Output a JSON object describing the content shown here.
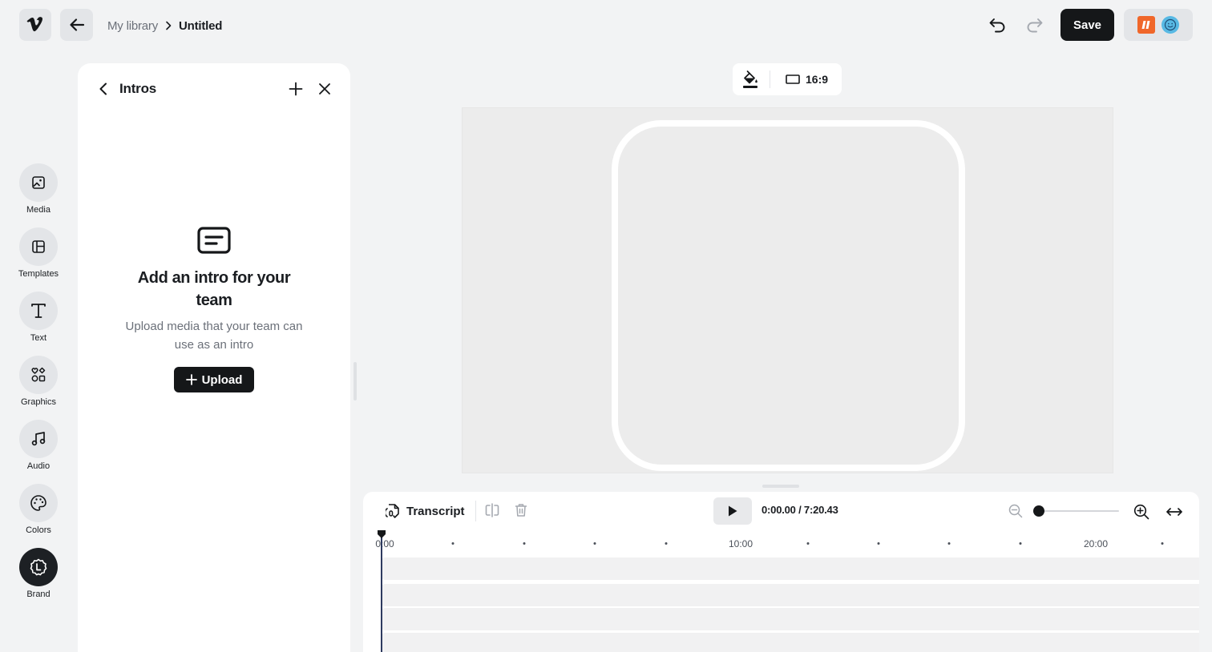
{
  "header": {
    "breadcrumb": {
      "library": "My library",
      "current": "Untitled"
    },
    "save_label": "Save"
  },
  "rail": {
    "items": [
      {
        "label": "Media",
        "icon": "image-icon"
      },
      {
        "label": "Templates",
        "icon": "layout-icon"
      },
      {
        "label": "Text",
        "icon": "text-icon"
      },
      {
        "label": "Graphics",
        "icon": "shapes-icon"
      },
      {
        "label": "Audio",
        "icon": "music-note-icon"
      },
      {
        "label": "Colors",
        "icon": "palette-icon"
      },
      {
        "label": "Brand",
        "icon": "brand-badge-icon",
        "active": true
      }
    ]
  },
  "panel": {
    "title": "Intros",
    "empty_heading": "Add an intro for your team",
    "empty_description": "Upload media that your team can use as an intro",
    "upload_label": "Upload"
  },
  "canvas": {
    "aspect_ratio": "16:9"
  },
  "timeline": {
    "transcript_label": "Transcript",
    "current_time": "0:00.00",
    "total_time": "7:20.43",
    "time_readout": "0:00.00 / 7:20.43",
    "zoom_level": 0,
    "ruler_labels": [
      "0:00",
      "10:00",
      "20:00"
    ]
  },
  "colors": {
    "background": "#f2f3f4",
    "primary_button": "#151719",
    "team_logo": "#f0672a",
    "avatar": "#58b9e4"
  }
}
